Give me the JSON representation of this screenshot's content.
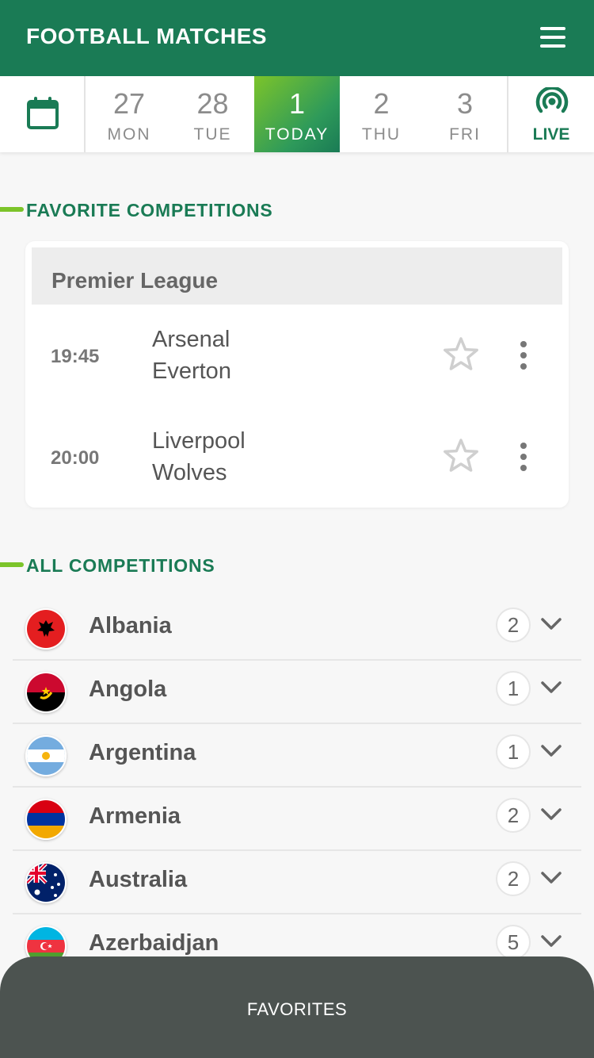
{
  "header": {
    "title": "FOOTBALL MATCHES",
    "menu_icon": "hamburger-menu-icon"
  },
  "date_strip": {
    "calendar_icon": "calendar-icon",
    "days": [
      {
        "num": "27",
        "dow": "MON",
        "selected": false
      },
      {
        "num": "28",
        "dow": "TUE",
        "selected": false
      },
      {
        "num": "1",
        "dow": "TODAY",
        "selected": true
      },
      {
        "num": "2",
        "dow": "THU",
        "selected": false
      },
      {
        "num": "3",
        "dow": "FRI",
        "selected": false
      }
    ],
    "live": {
      "label": "LIVE",
      "icon": "broadcast-icon"
    }
  },
  "favorites": {
    "title": "FAVORITE COMPETITIONS",
    "league": "Premier League",
    "matches": [
      {
        "time": "19:45",
        "home": "Arsenal",
        "away": "Everton"
      },
      {
        "time": "20:00",
        "home": "Liverpool",
        "away": "Wolves"
      }
    ]
  },
  "all_competitions": {
    "title": "ALL COMPETITIONS",
    "countries": [
      {
        "name": "Albania",
        "count": "2"
      },
      {
        "name": "Angola",
        "count": "1"
      },
      {
        "name": "Argentina",
        "count": "1"
      },
      {
        "name": "Armenia",
        "count": "2"
      },
      {
        "name": "Australia",
        "count": "2"
      },
      {
        "name": "Azerbaidjan",
        "count": "5"
      }
    ]
  },
  "bottom_bar": {
    "label": "FAVORITES"
  },
  "colors": {
    "brand_green": "#1a7b55",
    "accent_lime": "#7cc42a",
    "bottom_bar": "#4c5350"
  }
}
